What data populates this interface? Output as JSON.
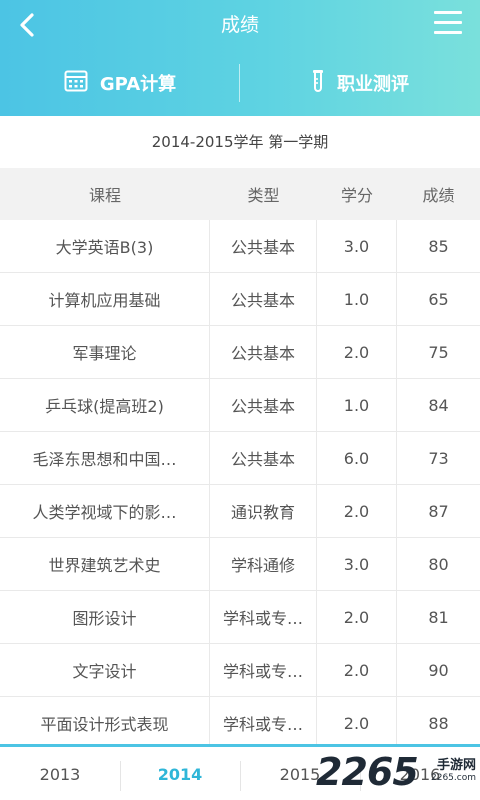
{
  "header": {
    "title": "成绩",
    "actions": [
      {
        "label": "GPA计算",
        "icon": "calculator-icon"
      },
      {
        "label": "职业测评",
        "icon": "test-tube-icon"
      }
    ]
  },
  "semester": "2014-2015学年 第一学期",
  "table": {
    "columns": [
      "课程",
      "类型",
      "学分",
      "成绩"
    ],
    "rows": [
      [
        "大学英语B(3)",
        "公共基本",
        "3.0",
        "85"
      ],
      [
        "计算机应用基础",
        "公共基本",
        "1.0",
        "65"
      ],
      [
        "军事理论",
        "公共基本",
        "2.0",
        "75"
      ],
      [
        "乒乓球(提高班2)",
        "公共基本",
        "1.0",
        "84"
      ],
      [
        "毛泽东思想和中国…",
        "公共基本",
        "6.0",
        "73"
      ],
      [
        "人类学视域下的影…",
        "通识教育",
        "2.0",
        "87"
      ],
      [
        "世界建筑艺术史",
        "学科通修",
        "3.0",
        "80"
      ],
      [
        "图形设计",
        "学科或专…",
        "2.0",
        "81"
      ],
      [
        "文字设计",
        "学科或专…",
        "2.0",
        "90"
      ],
      [
        "平面设计形式表现",
        "学科或专…",
        "2.0",
        "88"
      ]
    ]
  },
  "tabs": [
    {
      "label": "2013"
    },
    {
      "label": "2014"
    },
    {
      "label": "2015"
    },
    {
      "label": "2016"
    }
  ],
  "active_tab": 1,
  "watermark": {
    "number": "2265",
    "cn": "手游网",
    "url": "2265.com"
  },
  "colors": {
    "accent": "#4cc4e4",
    "accent_text": "#2fb6d8"
  }
}
